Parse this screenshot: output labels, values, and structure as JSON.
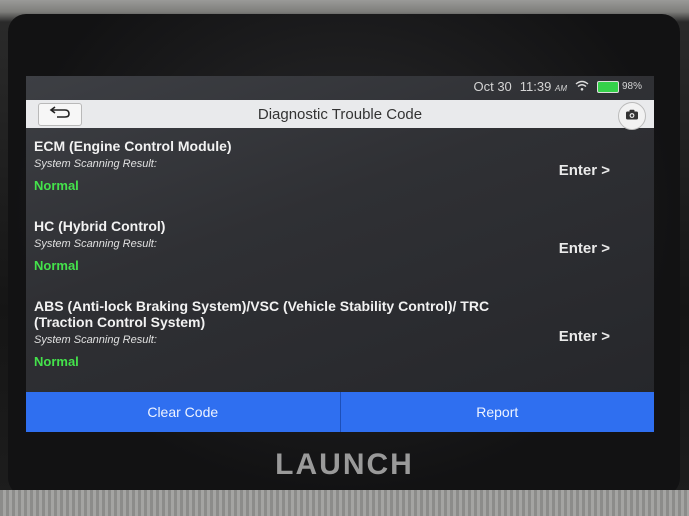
{
  "status_bar": {
    "date": "Oct 30",
    "time": "11:39",
    "time_suffix": "AM",
    "battery": "98%",
    "battery_level": 0.98,
    "icons": [
      "wifi-icon",
      "battery-icon"
    ]
  },
  "header": {
    "title": "Diagnostic Trouble Code",
    "back_icon": "back-arrow-icon",
    "camera_icon": "camera-icon"
  },
  "modules": [
    {
      "name": "ECM (Engine Control Module)",
      "result_label": "System Scanning Result:",
      "status": "Normal",
      "action": "Enter >"
    },
    {
      "name": "HC (Hybrid Control)",
      "result_label": "System Scanning Result:",
      "status": "Normal",
      "action": "Enter >"
    },
    {
      "name": "ABS (Anti-lock Braking System)/VSC (Vehicle Stability Control)/ TRC (Traction Control System)",
      "result_label": "System Scanning Result:",
      "status": "Normal",
      "action": "Enter >"
    }
  ],
  "footer": {
    "clear_label": "Clear Code",
    "report_label": "Report"
  },
  "device": {
    "brand": "LAUNCH"
  },
  "colors": {
    "normal_status": "#44e24b",
    "button_blue": "#2f6ff0",
    "title_bar": "#e9eaec"
  }
}
